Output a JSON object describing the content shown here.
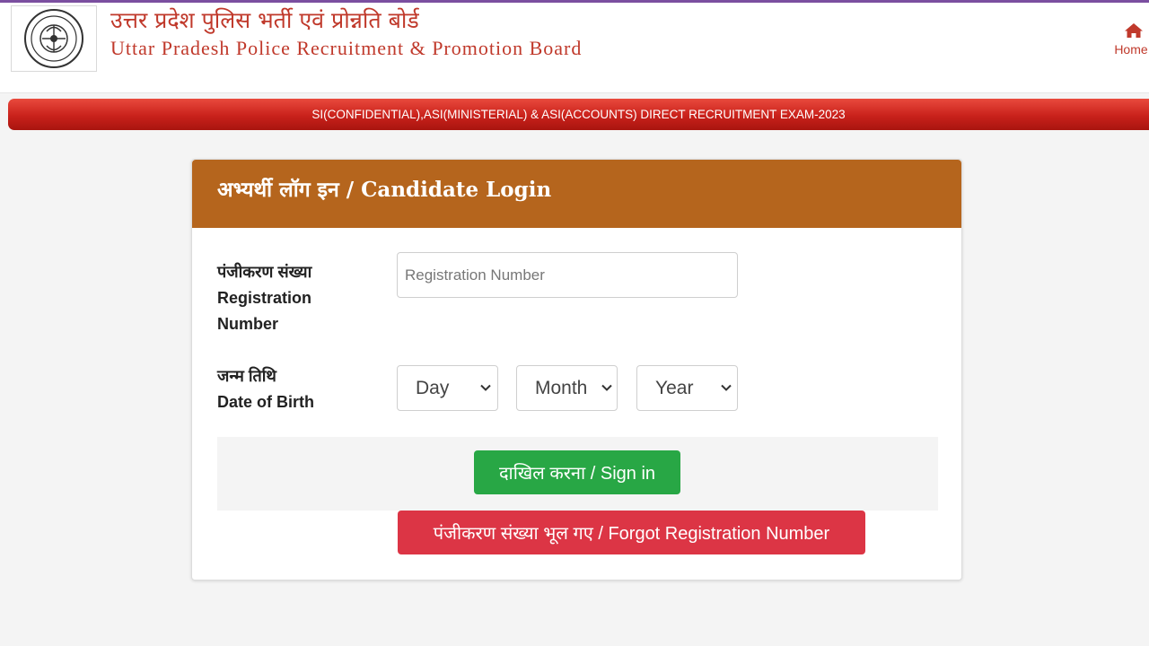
{
  "header": {
    "title_hindi": "उत्तर प्रदेश पुलिस भर्ती एवं प्रोन्नति बोर्ड",
    "title_english": "Uttar Pradesh Police Recruitment & Promotion Board",
    "logo_icon": "up-police-emblem",
    "nav": {
      "home_label": "Home",
      "home_icon": "home-icon"
    }
  },
  "banner": {
    "text": "SI(CONFIDENTIAL),ASI(MINISTERIAL) & ASI(ACCOUNTS) DIRECT RECRUITMENT EXAM-2023"
  },
  "login": {
    "title": "अभ्यर्थी लॉग इन / Candidate Login",
    "registration": {
      "label_hindi": "पंजीकरण संख्या",
      "label_english_1": "Registration",
      "label_english_2": "Number",
      "placeholder": "Registration Number",
      "value": ""
    },
    "dob": {
      "label_hindi": "जन्म तिथि",
      "label_english": "Date of Birth",
      "day": "Day",
      "month": "Month",
      "year": "Year"
    },
    "signin_label": "दाखिल करना / Sign in",
    "forgot_label": "पंजीकरण संख्या भूल गए / Forgot Registration Number"
  },
  "colors": {
    "accent_red": "#c0392b",
    "card_header": "#b5651d",
    "signin_green": "#28a745",
    "forgot_red": "#dc3545"
  }
}
